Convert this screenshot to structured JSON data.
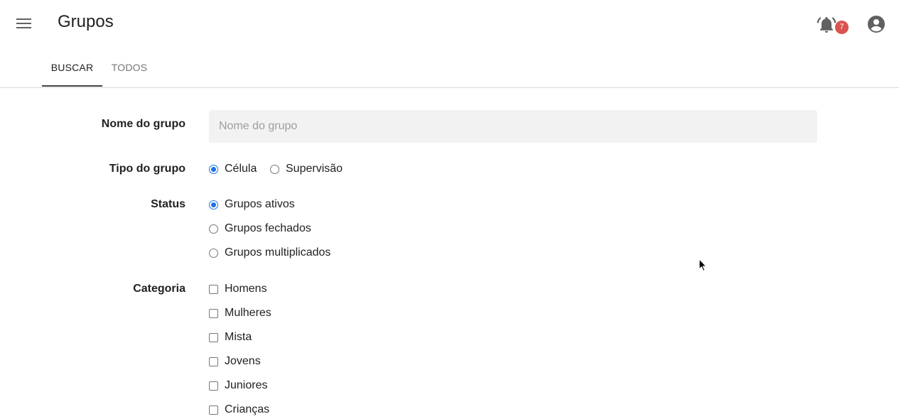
{
  "header": {
    "title": "Grupos",
    "notification_count": "7"
  },
  "tabs": [
    {
      "label": "BUSCAR",
      "active": true
    },
    {
      "label": "TODOS",
      "active": false
    }
  ],
  "form": {
    "name": {
      "label": "Nome do grupo",
      "value": "",
      "placeholder": "Nome do grupo"
    },
    "tipo": {
      "label": "Tipo do grupo",
      "options": [
        {
          "label": "Célula",
          "checked": true
        },
        {
          "label": "Supervisão",
          "checked": false
        }
      ]
    },
    "status": {
      "label": "Status",
      "options": [
        {
          "label": "Grupos ativos",
          "checked": true
        },
        {
          "label": "Grupos fechados",
          "checked": false
        },
        {
          "label": "Grupos multiplicados",
          "checked": false
        }
      ]
    },
    "categoria": {
      "label": "Categoria",
      "options": [
        {
          "label": "Homens",
          "checked": false
        },
        {
          "label": "Mulheres",
          "checked": false
        },
        {
          "label": "Mista",
          "checked": false
        },
        {
          "label": "Jovens",
          "checked": false
        },
        {
          "label": "Juniores",
          "checked": false
        },
        {
          "label": "Crianças",
          "checked": false
        }
      ]
    }
  },
  "colors": {
    "accent": "#1a73e8",
    "badge": "#d9534f",
    "input_bg": "#f2f2f2"
  },
  "icons": {
    "menu": "menu-icon",
    "notifications": "bell-icon",
    "account": "account-circle-icon"
  }
}
